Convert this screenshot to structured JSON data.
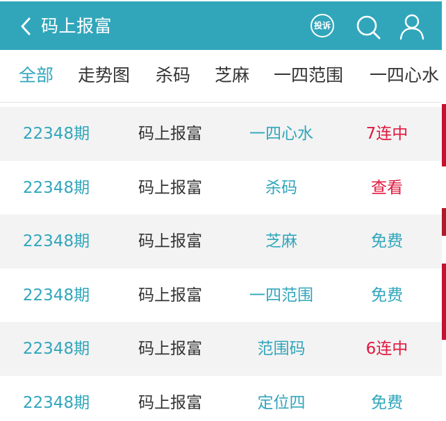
{
  "header": {
    "title": "码上报富",
    "complain_label": "投诉",
    "back_icon": "chevron-left-icon",
    "search_icon": "search-icon",
    "user_icon": "user-icon",
    "brand_color": "#31a6bb"
  },
  "tabs": [
    {
      "label": "全部",
      "active": true
    },
    {
      "label": "走势图",
      "active": false
    },
    {
      "label": "杀码",
      "active": false
    },
    {
      "label": "芝麻",
      "active": false
    },
    {
      "label": "一四范围",
      "active": false
    },
    {
      "label": "一四心水",
      "active": false
    }
  ],
  "rows": [
    {
      "issue": "22348期",
      "name": "码上报富",
      "category": "一四心水",
      "status": "7连中",
      "status_color": "#e0193f"
    },
    {
      "issue": "22348期",
      "name": "码上报富",
      "category": "杀码",
      "status": "查看",
      "status_color": "#e0193f"
    },
    {
      "issue": "22348期",
      "name": "码上报富",
      "category": "芝麻",
      "status": "免费",
      "status_color": "#31a6bb"
    },
    {
      "issue": "22348期",
      "name": "码上报富",
      "category": "一四范围",
      "status": "免费",
      "status_color": "#31a6bb"
    },
    {
      "issue": "22348期",
      "name": "码上报富",
      "category": "范围码",
      "status": "6连中",
      "status_color": "#e0193f"
    },
    {
      "issue": "22348期",
      "name": "码上报富",
      "category": "定位四",
      "status": "免费",
      "status_color": "#31a6bb"
    }
  ]
}
